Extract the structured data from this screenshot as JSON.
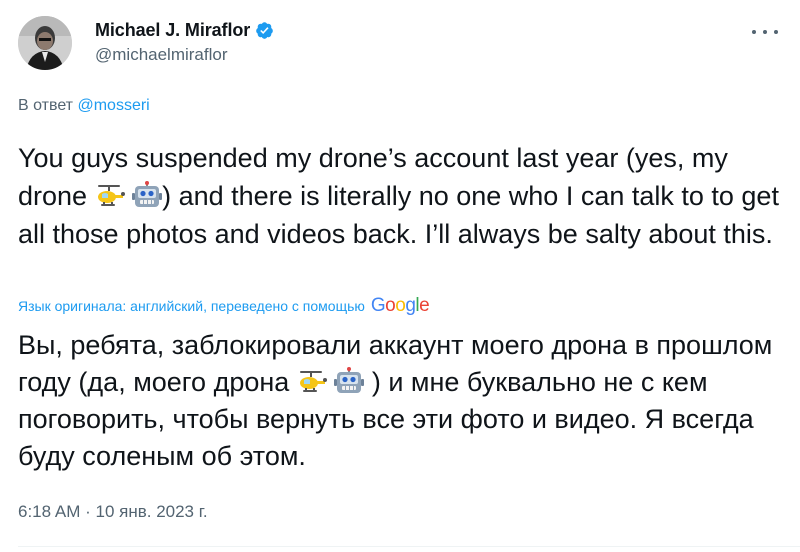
{
  "author": {
    "display_name": "Michael J. Miraflor",
    "handle": "@michaelmiraflor",
    "verified": true,
    "avatar_icon": "avatar-photo"
  },
  "reply": {
    "prefix": "В ответ",
    "mention": "@mosseri"
  },
  "tweet": {
    "text_part1": "You guys suspended my drone’s account last year (yes, my drone",
    "text_part2": ")  and there is literally no one who I can talk to to get all those photos and videos back. I’ll always be salty about this.",
    "emojis": [
      "helicopter-emoji",
      "robot-emoji"
    ]
  },
  "translation": {
    "label": "Язык оригинала: английский, переведено с помощью",
    "provider": "Google",
    "text_part1": "Вы, ребята, заблокировали аккаунт моего дрона в прошлом году (да, моего дрона",
    "text_part2": ") и мне буквально не с кем поговорить, чтобы вернуть все эти фото и видео. Я всегда буду соленым об этом."
  },
  "meta": {
    "time": "6:18 AM",
    "separator": " · ",
    "date": "10 янв. 2023 г."
  },
  "colors": {
    "accent": "#1d9bf0",
    "secondary_text": "#536471",
    "primary_text": "#0f1419"
  },
  "icons": {
    "verified": "verified-badge-icon",
    "more": "more-options-icon"
  }
}
